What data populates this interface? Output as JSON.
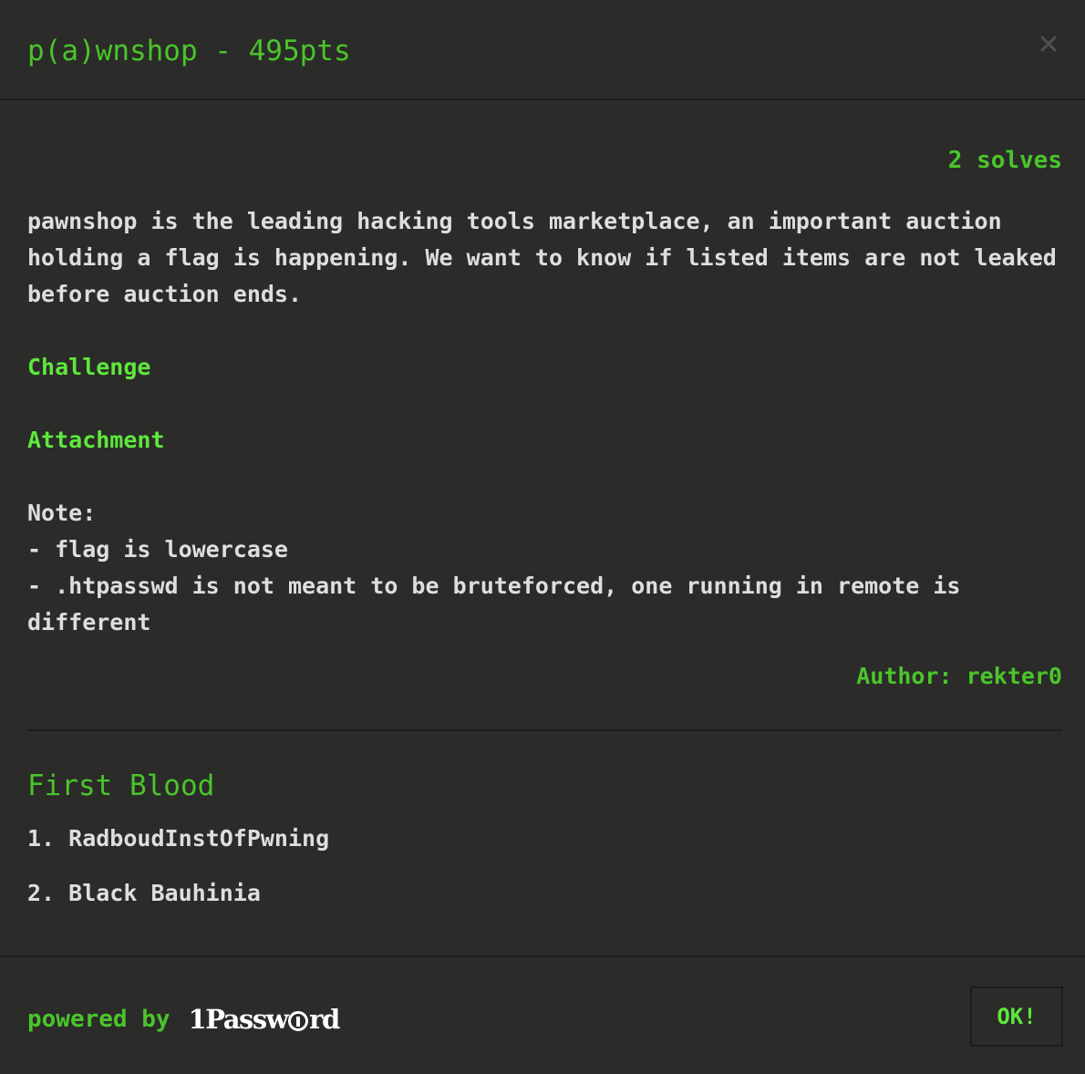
{
  "modal": {
    "title": "p(a)wnshop - 495pts",
    "close_icon": "close-icon",
    "solves": "2 solves",
    "description": {
      "paragraph": "pawnshop is the leading hacking tools marketplace, an important auction holding a flag is happening. We want to know if listed items are not leaked before auction ends.",
      "challenge_link": "Challenge",
      "attachment_link": "Attachment",
      "note_heading": "Note:",
      "note_line_1": "- flag is lowercase",
      "note_line_2": "- .htpasswd is not meant to be bruteforced, one running in remote is different"
    },
    "author": "Author: rekter0",
    "first_blood": {
      "title": "First Blood",
      "entries": [
        "1. RadboudInstOfPwning",
        "2. Black Bauhinia"
      ]
    },
    "footer": {
      "powered_by": "powered by",
      "brand_prefix": "1Passw",
      "brand_suffix": "rd",
      "ok_label": "OK!"
    }
  },
  "colors": {
    "background": "#2b2b29",
    "accent": "#4ac52b",
    "link": "#5ee83c",
    "text": "#dedede",
    "border": "#1c1c1b"
  }
}
